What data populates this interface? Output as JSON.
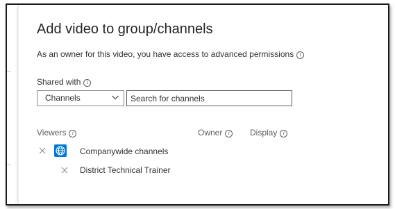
{
  "dialog": {
    "title": "Add video to group/channels",
    "description": "As an owner for this video, you have access to advanced permissions"
  },
  "shared_with": {
    "label": "Shared with",
    "select_value": "Channels",
    "search_placeholder": "Search for channels"
  },
  "columns": {
    "viewers": "Viewers",
    "owner": "Owner",
    "display": "Display"
  },
  "viewers": [
    {
      "name": "Companywide channels",
      "icon": "globe-icon"
    },
    {
      "name": "District Technical Trainer",
      "icon": "none"
    }
  ],
  "colors": {
    "accent": "#0078d4",
    "text": "#323130"
  }
}
